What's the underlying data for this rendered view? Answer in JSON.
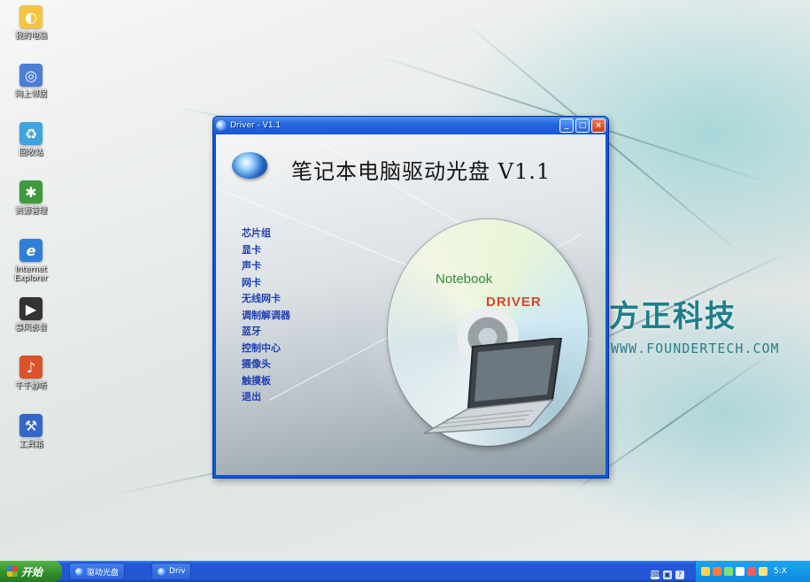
{
  "desktop": {
    "icons": [
      {
        "name": "my-computer-icon",
        "label": "我的电脑",
        "color": "#f5c542",
        "glyph": "💻"
      },
      {
        "name": "network-icon",
        "label": "网上邻居",
        "color": "#4b7fd6",
        "glyph": "🖧"
      },
      {
        "name": "recycle-icon",
        "label": "回收站",
        "color": "#3fa3e0",
        "glyph": "♻"
      },
      {
        "name": "explorer-icon",
        "label": "资源管理",
        "color": "#3c9b3c",
        "glyph": "✱"
      },
      {
        "name": "ie-icon",
        "label": "Internet Explorer",
        "color": "#2f7fd8",
        "glyph": "e"
      },
      {
        "name": "media-icon",
        "label": "暴风影音",
        "color": "#333333",
        "glyph": "▶"
      },
      {
        "name": "app-icon",
        "label": "千千静听",
        "color": "#d9542a",
        "glyph": "♪"
      },
      {
        "name": "tool-icon",
        "label": "工具箱",
        "color": "#3567c9",
        "glyph": "⚒"
      }
    ],
    "brand_name": "方正科技",
    "brand_url": "WWW.FOUNDERTECH.COM"
  },
  "window": {
    "title": "Driver - V1.1",
    "app_title": "笔记本电脑驱动光盘 V1.1",
    "menu": [
      "芯片组",
      "显卡",
      "声卡",
      "网卡",
      "无线网卡",
      "调制解调器",
      "蓝牙",
      "控制中心",
      "摄像头",
      "触摸板",
      "退出"
    ],
    "disc_text_1": "Notebook",
    "disc_text_2": "DRIVER"
  },
  "taskbar": {
    "start_label": "开始",
    "tasks": [
      "驱动光盘",
      "Driv"
    ],
    "clock": "5:X"
  }
}
